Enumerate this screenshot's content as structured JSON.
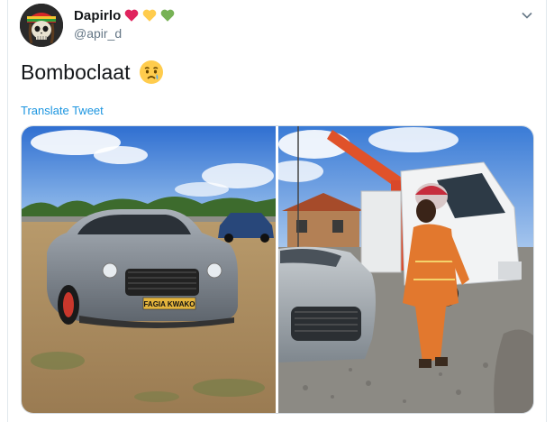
{
  "tweet": {
    "display_name": "Dapirlo",
    "handle": "@apir_d",
    "text": "Bomboclaat",
    "translate_label": "Translate Tweet",
    "plate_text": "FAGIA KWAKO"
  },
  "icons": {
    "hearts": [
      "red-heart",
      "yellow-heart",
      "green-heart"
    ],
    "emoji": "crying-face",
    "menu": "chevron-down"
  },
  "colors": {
    "link": "#1b95e0",
    "secondary_text": "#657786",
    "heart_red": "#e0245e",
    "heart_yellow": "#ffcc4d",
    "heart_green": "#77b255"
  }
}
